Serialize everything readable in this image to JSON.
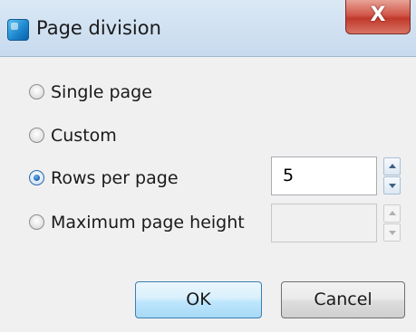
{
  "window": {
    "title": "Page division",
    "close_glyph": "X"
  },
  "options": [
    {
      "label": "Single page",
      "checked": false
    },
    {
      "label": "Custom",
      "checked": false
    },
    {
      "label": "Rows per page",
      "checked": true
    },
    {
      "label": "Maximum page height",
      "checked": false
    }
  ],
  "rows_per_page": {
    "value": "5",
    "enabled": true
  },
  "max_page_height": {
    "value": "",
    "enabled": false
  },
  "buttons": {
    "ok": "OK",
    "cancel": "Cancel"
  },
  "icons": {
    "app": "app-icon",
    "close": "close-icon",
    "spin_up": "spin-up-icon",
    "spin_down": "spin-down-icon"
  },
  "colors": {
    "titlebar": "#c7daee",
    "close": "#c0392b",
    "ok_border": "#3c7fb1",
    "radio_dot": "#1e5fae"
  }
}
